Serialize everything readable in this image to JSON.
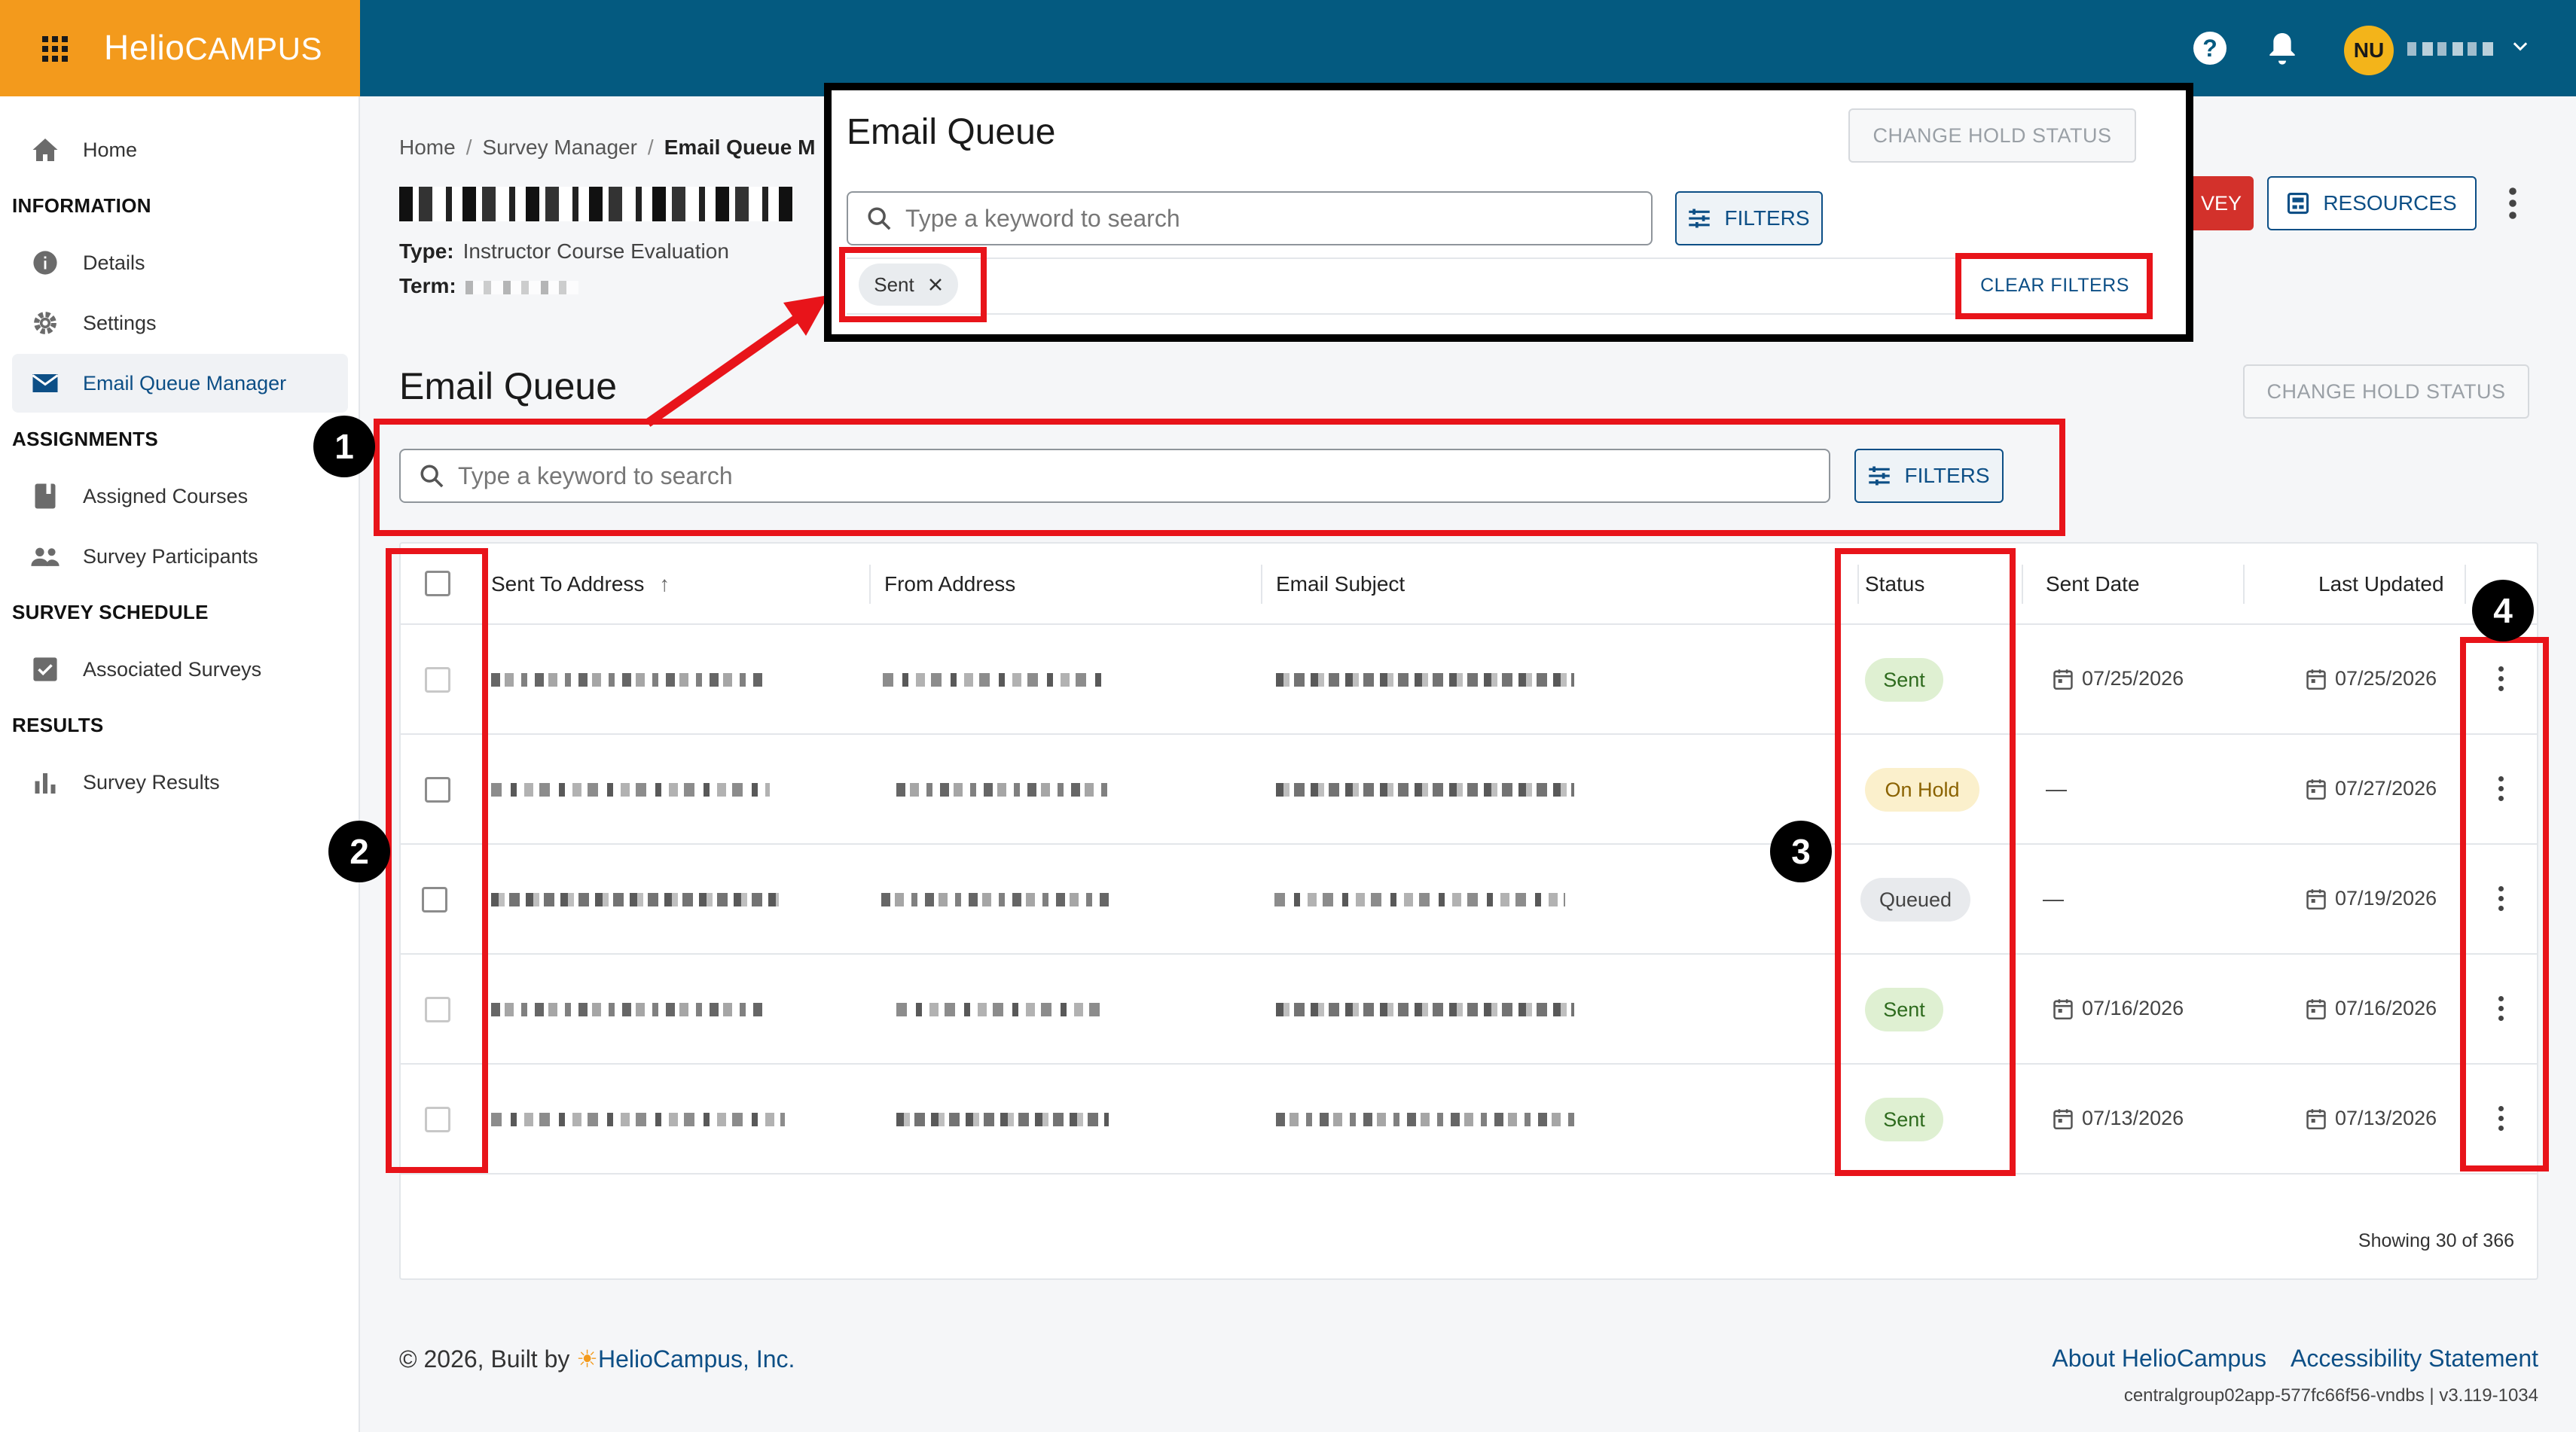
{
  "brand": {
    "logo_main": "Helio",
    "logo_sub": "CAMPUS"
  },
  "topbar": {
    "avatar_initials": "NU"
  },
  "sidebar": {
    "home": "Home",
    "sections": [
      {
        "heading": "INFORMATION",
        "items": [
          "Details",
          "Settings",
          "Email Queue Manager"
        ]
      },
      {
        "heading": "ASSIGNMENTS",
        "items": [
          "Assigned Courses",
          "Survey Participants"
        ]
      },
      {
        "heading": "SURVEY SCHEDULE",
        "items": [
          "Associated Surveys"
        ]
      },
      {
        "heading": "RESULTS",
        "items": [
          "Survey Results"
        ]
      }
    ]
  },
  "breadcrumb": {
    "home": "Home",
    "survey_manager": "Survey Manager",
    "current": "Email Queue M"
  },
  "survey": {
    "type_label": "Type:",
    "type_value": "Instructor Course Evaluation",
    "term_label": "Term:"
  },
  "actions": {
    "red_button": "VEY",
    "resources": "RESOURCES"
  },
  "email_queue": {
    "title": "Email Queue",
    "hold_button": "CHANGE HOLD STATUS",
    "search_placeholder": "Type a keyword to search",
    "filters_button": "FILTERS",
    "active_filter": "Sent",
    "clear_filters": "CLEAR FILTERS"
  },
  "table": {
    "columns": [
      "Sent To Address",
      "From Address",
      "Email Subject",
      "Status",
      "Sent Date",
      "Last Updated"
    ],
    "rows": [
      {
        "status": "Sent",
        "status_kind": "sent",
        "sent_date": "07/25/2026",
        "last_updated": "07/25/2026"
      },
      {
        "status": "On Hold",
        "status_kind": "hold",
        "sent_date": "—",
        "last_updated": "07/27/2026"
      },
      {
        "status": "Queued",
        "status_kind": "queued",
        "sent_date": "—",
        "last_updated": "07/19/2026"
      },
      {
        "status": "Sent",
        "status_kind": "sent",
        "sent_date": "07/16/2026",
        "last_updated": "07/16/2026"
      },
      {
        "status": "Sent",
        "status_kind": "sent",
        "sent_date": "07/13/2026",
        "last_updated": "07/13/2026"
      }
    ],
    "showing": "Showing 30 of 366"
  },
  "footer": {
    "copyright": "© 2026, Built by",
    "company": "HelioCampus, Inc.",
    "about": "About HelioCampus",
    "accessibility": "Accessibility Statement",
    "build": "centralgroup02app-577fc66f56-vndbs | v3.119-1034"
  },
  "annotations": [
    "1",
    "2",
    "3",
    "4"
  ],
  "colors": {
    "topbar": "#045a80",
    "brand": "#f39a1c",
    "accent": "#0d4f86",
    "annotation": "#e8141a"
  }
}
